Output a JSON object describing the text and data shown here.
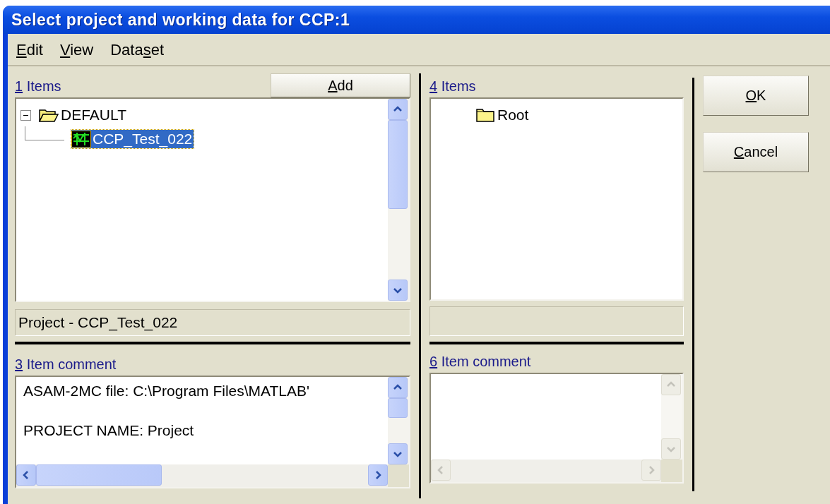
{
  "window": {
    "title": "Select project and working data for CCP:1"
  },
  "menu": [
    {
      "key": "E",
      "after": "dit"
    },
    {
      "key": "V",
      "after": "iew"
    },
    {
      "before": "Data",
      "key": "s",
      "after": "et"
    }
  ],
  "left_pane": {
    "items_label": {
      "key": "1",
      "after": " Items"
    },
    "add_button": {
      "key": "A",
      "after": "dd"
    },
    "tree": [
      {
        "label": "DEFAULT",
        "kind": "folder-open",
        "expanded": true,
        "selected": false,
        "children": [
          {
            "label": "CCP_Test_022",
            "kind": "dataset",
            "selected": true
          }
        ]
      }
    ],
    "status": "Project - CCP_Test_022",
    "comment_label": {
      "key": "3",
      "after": " Item comment"
    },
    "comment": {
      "scrollable": true,
      "lines": [
        "ASAM-2MC file: C:\\Program Files\\MATLAB'",
        "PROJECT NAME: Project"
      ]
    }
  },
  "right_pane": {
    "items_label": {
      "key": "4",
      "after": " Items"
    },
    "tree": [
      {
        "label": "Root",
        "kind": "folder",
        "selected": false
      }
    ],
    "comment_label": {
      "key": "6",
      "after": " Item comment"
    },
    "comment": {
      "scrollable": false
    }
  },
  "buttons": [
    {
      "key": "O",
      "after": "K"
    },
    {
      "key": "C",
      "after": "ancel"
    }
  ]
}
